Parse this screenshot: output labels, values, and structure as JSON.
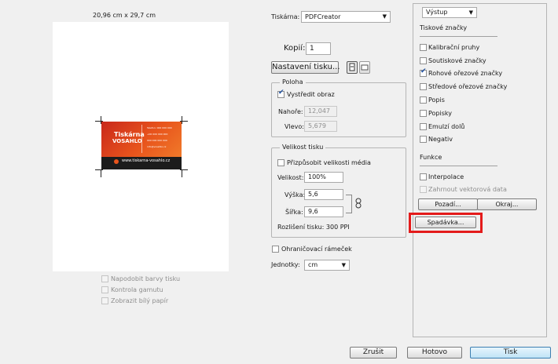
{
  "preview": {
    "paper_size": "20,96 cm x 29,7 cm",
    "card": {
      "brand_line1": "Tiskárna",
      "brand_line2": "VOSAHLO",
      "url": "www.tiskarna-vosahlo.cz",
      "contacts": [
        "Telefon: 000 000 000",
        "+00 000 000 000",
        "000 000 000 000",
        "info@vosahlo.cz"
      ]
    }
  },
  "preview_options": [
    {
      "label": "Napodobit barvy tisku",
      "checked": false,
      "enabled": false
    },
    {
      "label": "Kontrola gamutu",
      "checked": false,
      "enabled": false
    },
    {
      "label": "Zobrazit bílý papír",
      "checked": false,
      "enabled": false
    }
  ],
  "printer": {
    "label": "Tiskárna:",
    "value": "PDFCreator",
    "copies_label": "Kopií:",
    "copies_value": "1",
    "setup_button": "Nastavení tisku..."
  },
  "position_group": {
    "title": "Poloha",
    "center_label": "Vystředit obraz",
    "center_checked": true,
    "top_label": "Nahoře:",
    "top_value": "12,047",
    "left_label": "Vlevo:",
    "left_value": "5,679"
  },
  "size_group": {
    "title": "Velikost tisku",
    "fit_label": "Přizpůsobit velikosti média",
    "fit_checked": false,
    "scale_label": "Velikost:",
    "scale_value": "100%",
    "height_label": "Výška:",
    "height_value": "5,6",
    "width_label": "Šířka:",
    "width_value": "9,6",
    "resolution_text": "Rozlišení tisku: 300 PPI"
  },
  "bounding_box": {
    "label": "Ohraničovací rámeček",
    "checked": false
  },
  "units": {
    "label": "Jednotky:",
    "value": "cm"
  },
  "output_panel": {
    "dropdown_value": "Výstup",
    "marks_title": "Tiskové značky",
    "marks": [
      {
        "label": "Kalibrační pruhy",
        "checked": false
      },
      {
        "label": "Soutiskové značky",
        "checked": false
      },
      {
        "label": "Rohové ořezové značky",
        "checked": true
      },
      {
        "label": "Středové ořezové značky",
        "checked": false
      },
      {
        "label": "Popis",
        "checked": false
      },
      {
        "label": "Popisky",
        "checked": false
      },
      {
        "label": "Emulzí dolů",
        "checked": false
      },
      {
        "label": "Negativ",
        "checked": false
      }
    ],
    "functions_title": "Funkce",
    "interpolation_label": "Interpolace",
    "vector_label": "Zahrnout vektorová data",
    "background_button": "Pozadí...",
    "border_button": "Okraj...",
    "bleed_button": "Spadávka..."
  },
  "footer": {
    "cancel": "Zrušit",
    "done": "Hotovo",
    "print": "Tisk"
  },
  "colors": {
    "highlight": "#e41b1b",
    "card_orange": "#e8541c",
    "card_dark": "#1c1c1c",
    "print_button": "#bfe3f6"
  }
}
